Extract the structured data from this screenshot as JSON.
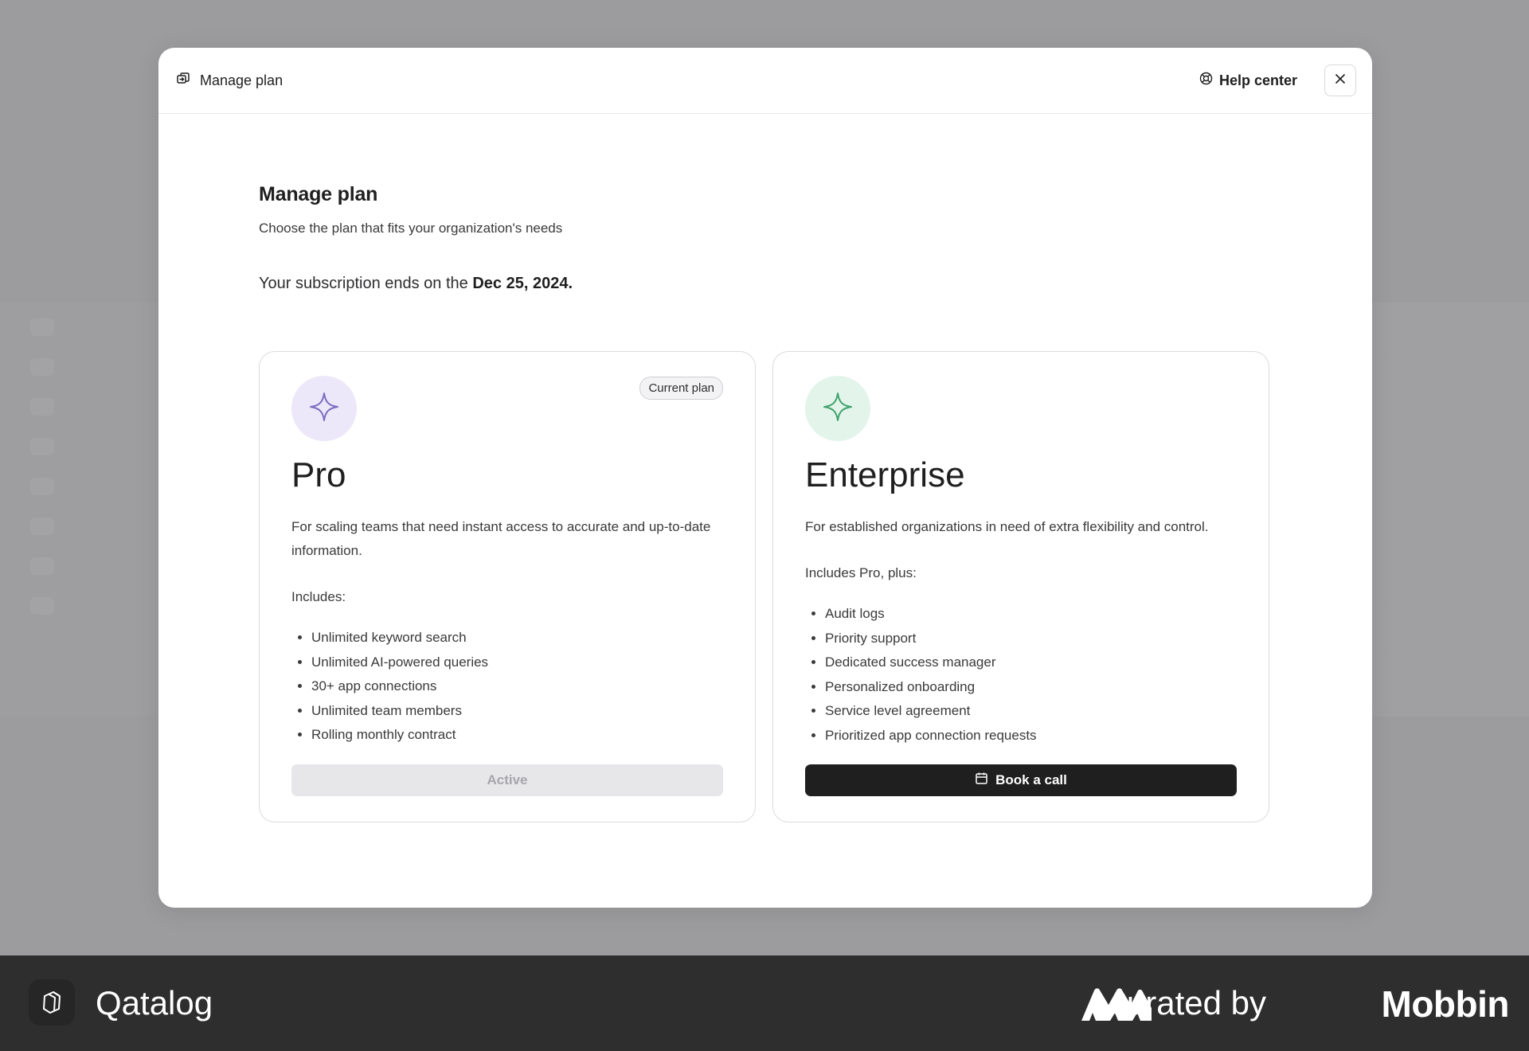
{
  "modal": {
    "header": {
      "title": "Manage plan",
      "title_icon": "swap-card-icon",
      "help_label": "Help center",
      "help_icon": "lifebuoy-icon",
      "close_icon": "close-icon"
    },
    "title": "Manage plan",
    "subtitle": "Choose the plan that fits your organization's needs",
    "subscription_prefix": "Your subscription ends on the ",
    "subscription_date": "Dec 25, 2024."
  },
  "plans": {
    "pro": {
      "icon": "sparkle-icon",
      "icon_color": "#7c6bbf",
      "icon_bg": "#ece8fa",
      "badge": "Current plan",
      "name": "Pro",
      "description": "For scaling teams that need instant access to accurate and up-to-date information.",
      "includes_label": "Includes:",
      "features": [
        "Unlimited keyword search",
        "Unlimited AI-powered queries",
        "30+ app connections",
        "Unlimited team members",
        "Rolling monthly contract"
      ],
      "button_label": "Active"
    },
    "enterprise": {
      "icon": "sparkle-icon",
      "icon_color": "#3fa36c",
      "icon_bg": "#e3f5ea",
      "name": "Enterprise",
      "description": "For established organizations in need of extra flexibility and control.",
      "includes_label": "Includes Pro, plus:",
      "features": [
        "Audit logs",
        "Priority support",
        "Dedicated success manager",
        "Personalized onboarding",
        "Service level agreement",
        "Prioritized app connection requests"
      ],
      "button_label": "Book a call",
      "button_icon": "calendar-icon"
    }
  },
  "footer": {
    "brand": "Qatalog",
    "curated_by": "curated by",
    "mobbin": "Mobbin"
  }
}
